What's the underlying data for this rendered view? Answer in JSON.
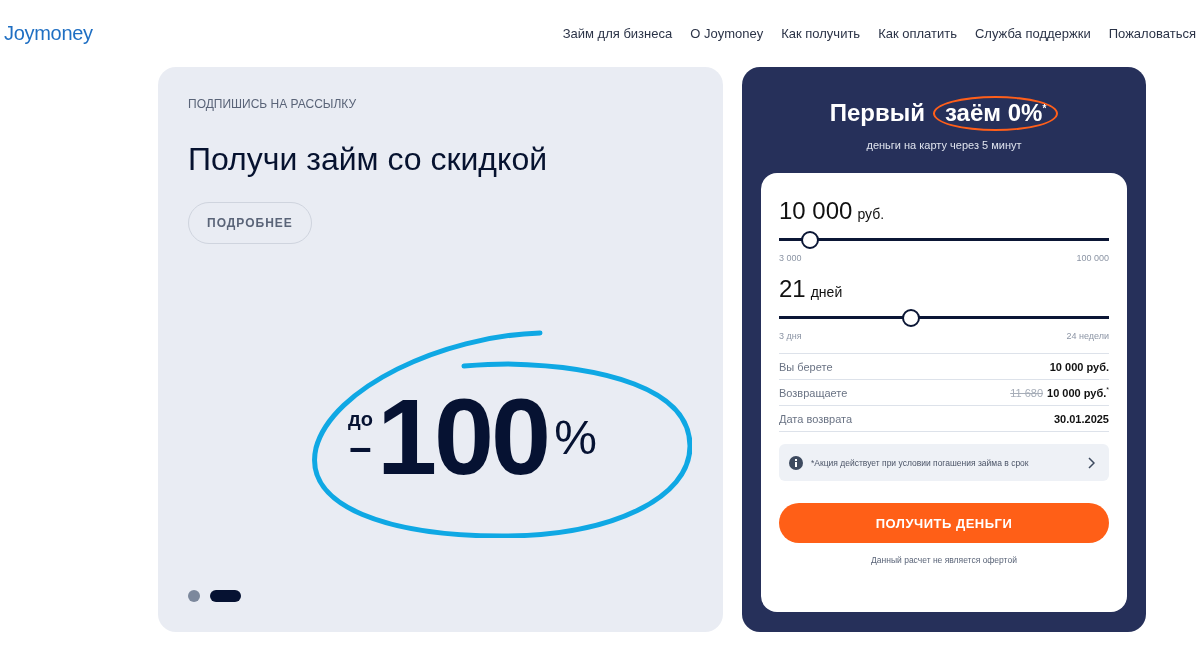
{
  "header": {
    "logo": "Joymoney",
    "nav": [
      "Займ для бизнеса",
      "О Joymoney",
      "Как получить",
      "Как оплатить",
      "Служба поддержки",
      "Пожаловаться"
    ]
  },
  "promo": {
    "eyebrow": "ПОДПИШИСЬ НА РАССЫЛКУ",
    "title": "Получи займ со скидкой",
    "button": "ПОДРОБНЕЕ",
    "prefix": "до",
    "minus": "–",
    "number": "100",
    "suffix": "%",
    "slides": [
      {
        "selected": false
      },
      {
        "selected": true
      }
    ]
  },
  "calculator": {
    "title": "Первый",
    "title_highlight": "заём 0%$^{*}$",
    "subtitle": "деньги на карту через 5 минут",
    "sliders": [
      {
        "value": "10 000",
        "unit": "руб.",
        "level": 0.094,
        "min": "3 000",
        "max": "100 000"
      },
      {
        "value": "21",
        "unit": "дней",
        "level": 0.4,
        "min": "3 дня",
        "max": "24 недели"
      }
    ],
    "summary": [
      {
        "label": "Вы берете",
        "value": "10 000 руб."
      },
      {
        "label": "Возвращаете",
        "old_value": "11 680",
        "value": "10 000 руб.$^{*}$"
      },
      {
        "label": "Дата возврата",
        "value": "30.01.2025"
      }
    ],
    "notice": "*Акция действует при условии погашения займа в срок",
    "button": "ПОЛУЧИТЬ ДЕНЬГИ",
    "disclaimer": "Данный расчет не является офертой"
  }
}
